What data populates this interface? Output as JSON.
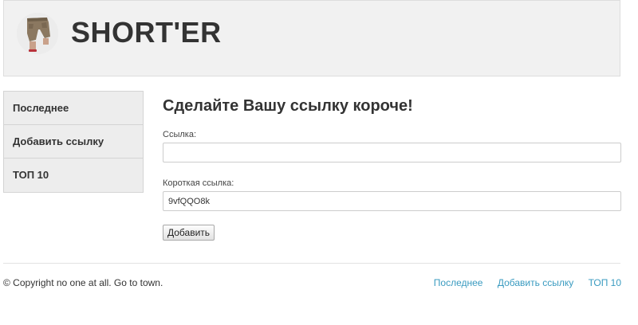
{
  "header": {
    "logo_alt": "shorts-logo",
    "site_title": "SHORT'ER"
  },
  "sidebar": {
    "items": [
      {
        "label": "Последнее"
      },
      {
        "label": "Добавить ссылку"
      },
      {
        "label": "ТОП 10"
      }
    ]
  },
  "main": {
    "title": "Сделайте Вашу ссылку короче!",
    "link_field": {
      "label": "Ссылка:",
      "value": ""
    },
    "short_field": {
      "label": "Короткая ссылка:",
      "value": "9vfQQO8k"
    },
    "submit_label": "Добавить"
  },
  "footer": {
    "copyright": "© Copyright no one at all. Go to town.",
    "links": [
      {
        "label": "Последнее"
      },
      {
        "label": "Добавить ссылку"
      },
      {
        "label": "ТОП 10"
      }
    ],
    "link_color": "#3a9bc0"
  }
}
